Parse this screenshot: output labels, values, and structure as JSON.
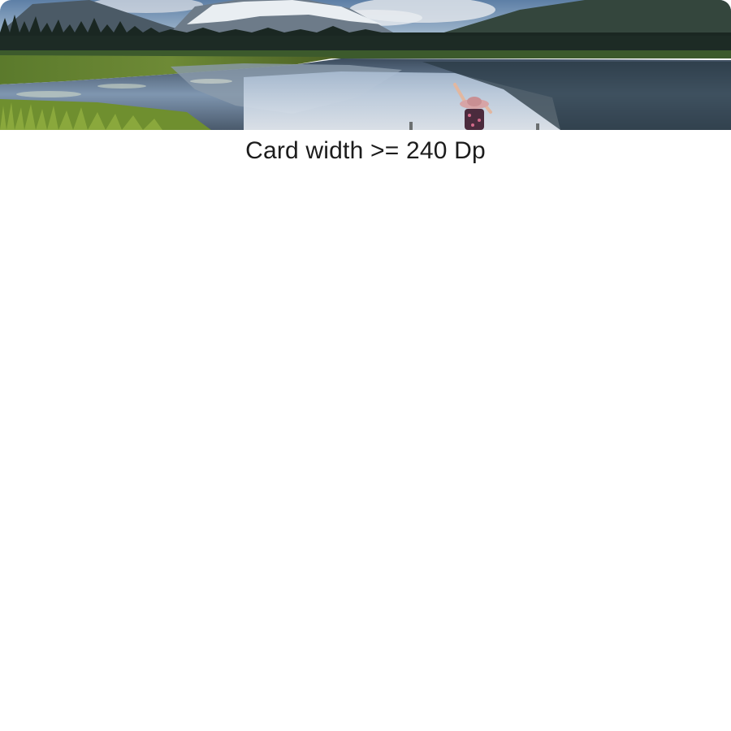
{
  "card": {
    "image_subject": "landscape-photo-lake-mountains",
    "caption": "Card width >= 240 Dp"
  },
  "colors": {
    "background": "#ffffff",
    "caption_text": "#1c1c1c"
  }
}
